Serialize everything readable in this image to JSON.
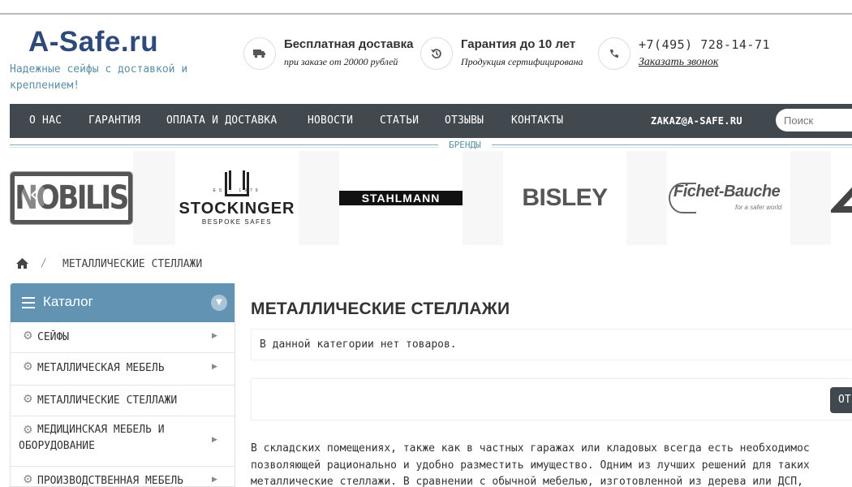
{
  "header": {
    "logo": "A-Safe.ru",
    "tagline": "Надежные сейфы с доставкой и креплением!",
    "features": [
      {
        "icon": "truck-icon",
        "title": "Бесплатная доставка",
        "subtitle": "при заказе от 20000 рублей"
      },
      {
        "icon": "history-icon",
        "title": "Гарантия до 10 лет",
        "subtitle": "Продукция сертифицирована"
      },
      {
        "icon": "phone-icon",
        "title": "+7(495) 728-14-71",
        "subtitle": "Заказать звонок"
      }
    ]
  },
  "nav": {
    "items": [
      "О НАС",
      "ГАРАНТИЯ",
      "ОПЛАТА И ДОСТАВКА",
      "НОВОСТИ",
      "СТАТЬИ",
      "ОТЗЫВЫ",
      "КОНТАКТЫ"
    ],
    "email": "ZAKAZ@A-SAFE.RU",
    "search_placeholder": "Поиск"
  },
  "brands": {
    "label": "БРЕНДЫ",
    "items": [
      {
        "name": "NOBILIS"
      },
      {
        "name": "STOCKINGER",
        "est": "EST. 1979",
        "sub": "BESPOKE SAFES"
      },
      {
        "name": "STAHLMANN"
      },
      {
        "name": "BISLEY"
      },
      {
        "name": "Fichet-Bauche",
        "sub": "for a safer world"
      }
    ]
  },
  "breadcrumb": {
    "current": "МЕТАЛЛИЧЕСКИЕ СТЕЛЛАЖИ",
    "separator": "/"
  },
  "catalog": {
    "title": "Каталог",
    "items": [
      {
        "label": "СЕЙФЫ",
        "has_children": true
      },
      {
        "label": "МЕТАЛЛИЧЕСКАЯ МЕБЕЛЬ",
        "has_children": true
      },
      {
        "label": "МЕТАЛЛИЧЕСКИЕ СТЕЛЛАЖИ",
        "has_children": false
      },
      {
        "label": "МЕДИЦИНСКАЯ МЕБЕЛЬ И ОБОРУДОВАНИЕ",
        "has_children": true
      },
      {
        "label": "ПРОИЗВОДСТВЕННАЯ МЕБЕЛЬ",
        "has_children": true
      }
    ]
  },
  "main": {
    "title": "МЕТАЛЛИЧЕСКИЕ СТЕЛЛАЖИ",
    "empty_message": "В данной категории нет товаров.",
    "filter_button": "ОТ",
    "description_lines": [
      "В складских помещениях, также как в частных гаражах или кладовых всегда есть необходимос",
      "позволяющей рационально и удобно разместить имущество. Одним из лучших решений для таких",
      "металлические стеллажи. В сравнении с обычной мебелью, изготовленной из дерева или ДСП,"
    ]
  },
  "colors": {
    "nav_bg": "#41494f",
    "catalog_header": "#6293b3",
    "logo": "#2e4a7a",
    "accent": "#5b8fa6"
  }
}
